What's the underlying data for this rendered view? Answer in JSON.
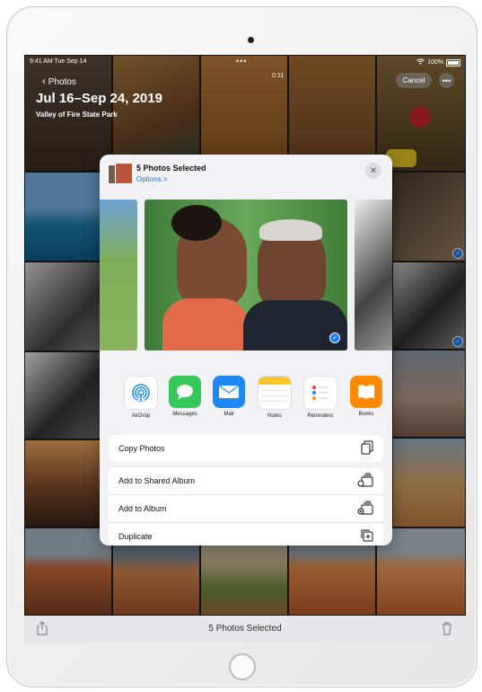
{
  "status": {
    "time_date": "9:41 AM  Tue Sep 14",
    "battery": "100%"
  },
  "header": {
    "back_label": "Photos",
    "title": "Jul 16–Sep 24, 2019",
    "subtitle": "Valley of Fire State Park",
    "cancel_label": "Cancel",
    "more_label": "•••"
  },
  "grid": {
    "video_duration": "0:11"
  },
  "share_sheet": {
    "title": "5 Photos Selected",
    "options_label": "Options >",
    "apps": [
      {
        "label": "AirDrop",
        "icon": "airdrop-icon",
        "color": "#ffffff"
      },
      {
        "label": "Messages",
        "icon": "messages-icon",
        "color": "#34c759"
      },
      {
        "label": "Mail",
        "icon": "mail-icon",
        "color": "#1e88f5"
      },
      {
        "label": "Notes",
        "icon": "notes-icon",
        "color": "#ffffff"
      },
      {
        "label": "Reminders",
        "icon": "reminders-icon",
        "color": "#ffffff"
      },
      {
        "label": "Books",
        "icon": "books-icon",
        "color": "#ff8a00"
      }
    ],
    "actions": [
      {
        "label": "Copy Photos",
        "icon": "copy-icon"
      },
      {
        "label": "Add to Shared Album",
        "icon": "shared-album-icon"
      },
      {
        "label": "Add to Album",
        "icon": "album-icon"
      },
      {
        "label": "Duplicate",
        "icon": "duplicate-icon"
      }
    ]
  },
  "bottom_bar": {
    "label": "5 Photos Selected"
  },
  "colors": {
    "accent": "#1e7cf2",
    "sheet_bg": "#f2f2f6"
  }
}
